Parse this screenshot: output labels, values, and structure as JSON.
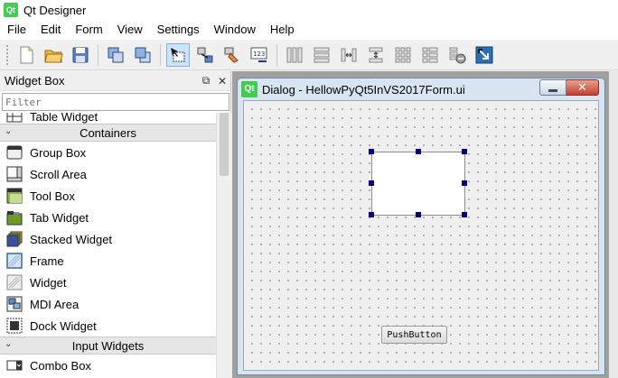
{
  "window": {
    "title": "Qt Designer",
    "app_icon_text": "Qt"
  },
  "menu": [
    "File",
    "Edit",
    "Form",
    "View",
    "Settings",
    "Window",
    "Help"
  ],
  "toolbar": {
    "groups": [
      [
        "new-file-icon",
        "open-folder-icon",
        "save-icon"
      ],
      [
        "send-to-back-icon",
        "bring-to-front-icon"
      ],
      [
        "edit-widgets-icon",
        "edit-signals-slots-icon",
        "edit-buddies-icon",
        "edit-tab-order-icon"
      ],
      [
        "layout-horizontal-icon",
        "layout-vertical-icon",
        "layout-h-splitter-icon",
        "layout-v-splitter-icon",
        "layout-grid-icon",
        "layout-form-icon",
        "break-layout-icon",
        "adjust-size-icon"
      ]
    ],
    "active": "edit-widgets-icon"
  },
  "widget_box": {
    "title": "Widget Box",
    "float_icon": "⧉",
    "close_icon": "✕",
    "filter_placeholder": "Filter",
    "partial_item": "Table Widget",
    "categories": [
      {
        "name": "Containers",
        "items": [
          "Group Box",
          "Scroll Area",
          "Tool Box",
          "Tab Widget",
          "Stacked Widget",
          "Frame",
          "Widget",
          "MDI Area",
          "Dock Widget"
        ]
      },
      {
        "name": "Input Widgets",
        "items": [
          "Combo Box"
        ]
      }
    ]
  },
  "dialog": {
    "title": "Dialog - HellowPyQt5InVS2017Form.ui",
    "icon_text": "Qt",
    "close_glyph": "✕",
    "push_button_label": "PushButton"
  },
  "colors": {
    "selection_handle": "#000080",
    "qt_green": "#41cd52",
    "close_red": "#c2412c"
  }
}
